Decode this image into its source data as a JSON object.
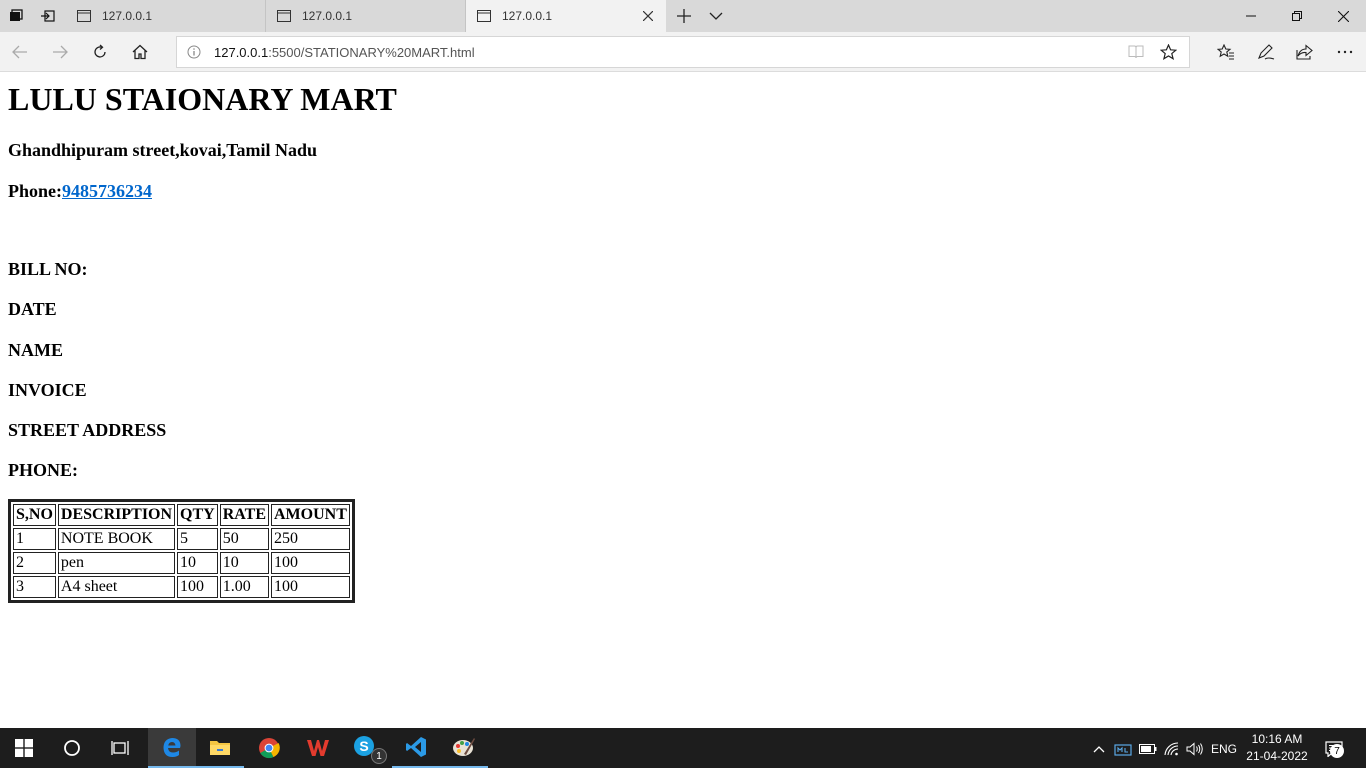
{
  "browser": {
    "tabs": [
      {
        "title": "127.0.0.1",
        "active": false
      },
      {
        "title": "127.0.0.1",
        "active": false
      },
      {
        "title": "127.0.0.1",
        "active": true
      }
    ],
    "address": {
      "host": "127.0.0.1",
      "path": ":5500/STATIONARY%20MART.html"
    }
  },
  "page": {
    "shop_name": "LULU STAIONARY MART",
    "address": "Ghandhipuram street,kovai,Tamil Nadu",
    "phone_label": "Phone:",
    "phone_number": "9485736234",
    "fields": {
      "bill_no": "BILL NO:",
      "date": "DATE",
      "name": "NAME",
      "invoice": "INVOICE",
      "street_address": "STREET ADDRESS",
      "phone": "PHONE:"
    },
    "table": {
      "headers": [
        "S,NO",
        "DESCRIPTION",
        "QTY",
        "RATE",
        "AMOUNT"
      ],
      "rows": [
        [
          "1",
          "NOTE BOOK",
          "5",
          "50",
          "250"
        ],
        [
          "2",
          "pen",
          "10",
          "10",
          "100"
        ],
        [
          "3",
          "A4 sheet",
          "100",
          "1.00",
          "100"
        ]
      ]
    }
  },
  "taskbar": {
    "tray_language": "ENG",
    "time": "10:16 AM",
    "date": "21-04-2022",
    "skype_badge": "1",
    "notification_count": "7"
  },
  "colors": {
    "link": "#0066cc",
    "taskbar_bg": "#1d1d1d",
    "tabstrip_bg": "#d9d9d9",
    "active_tab_bg": "#f2f2f2",
    "taskbar_accent": "#76b9ed"
  }
}
